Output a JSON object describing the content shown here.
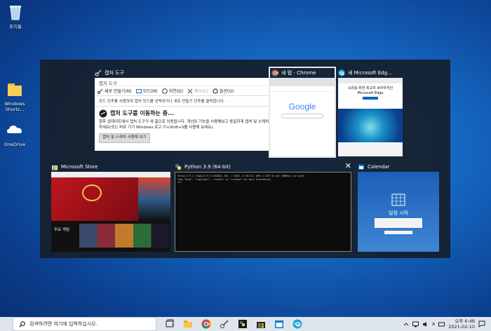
{
  "desktop": {
    "icons": [
      {
        "label": "휴지통",
        "icon": "recycle-bin-icon"
      },
      {
        "label": "Windows Shorts...",
        "icon": "folder-icon"
      },
      {
        "label": "OneDrive",
        "icon": "onedrive-icon"
      }
    ]
  },
  "switcher": {
    "windows": [
      {
        "title": "캡처 도구",
        "icon": "snipping-tool-icon",
        "content": {
          "app_title": "캡처 도구",
          "toolbar": [
            "새로 만들기(N)",
            "모드(M)",
            "지연(D)",
            "취소(C)",
            "옵션(O)"
          ],
          "hint": "모드 단추를 사용하여 캡처 모드를 선택하거나 새로 만들기 단추를 클릭합니다.",
          "notice_title": "캡처 도구를 이동하는 중...",
          "notice_body": "향후 업데이트에서 캡처 도구가 새 홈으로 이동됩니다. 개선된 기능을 사용해보고 동일하게 캡처 및 스케치를 사용해서 캡처하세요(또는 바로 가기 Windows 로고 키+Shift+S를 사용해 보세요).",
          "notice_button": "캡처 및 스케치 사용해 보기"
        }
      },
      {
        "title": "새 탭 - Chrome",
        "icon": "chrome-icon",
        "selected": true,
        "logo": "Google"
      },
      {
        "title": "새 Microsoft Edg...",
        "icon": "edge-icon",
        "headline": "소유를 위한 최고의 브라우저인 Microsoft Edge"
      },
      {
        "title": "Microsoft Store",
        "icon": "store-icon",
        "section": "주요 게임"
      },
      {
        "title": "Python 3.9 (64-bit)",
        "icon": "python-icon",
        "console": "Python 3.9.1 (tags/v3.9.1:1e5d33e, Dec  7 2020, 17:08:21) [MSC v.1927 64 bit (AMD64)] on win32\nType \"help\", \"copyright\", \"credits\" or \"license\" for more information.\n>>>"
      },
      {
        "title": "Calendar",
        "icon": "calendar-icon",
        "heading": "일정 시작"
      }
    ],
    "close_symbol": "✕"
  },
  "taskbar": {
    "search_placeholder": "검색하려면 여기에 입력하십시오.",
    "apps": [
      "task-view-icon",
      "file-explorer-icon",
      "chrome-icon",
      "snipping-tool-icon",
      "python-icon",
      "store-icon",
      "calendar-icon",
      "edge-icon"
    ],
    "tray_time": "오후 6:48",
    "tray_date": "2021-02-10",
    "ime": "A"
  },
  "colors": {
    "accent": "#0078d7",
    "overlay": "#161f2c",
    "chrome_blue": "#4285f4",
    "store_red": "#c0161f"
  }
}
